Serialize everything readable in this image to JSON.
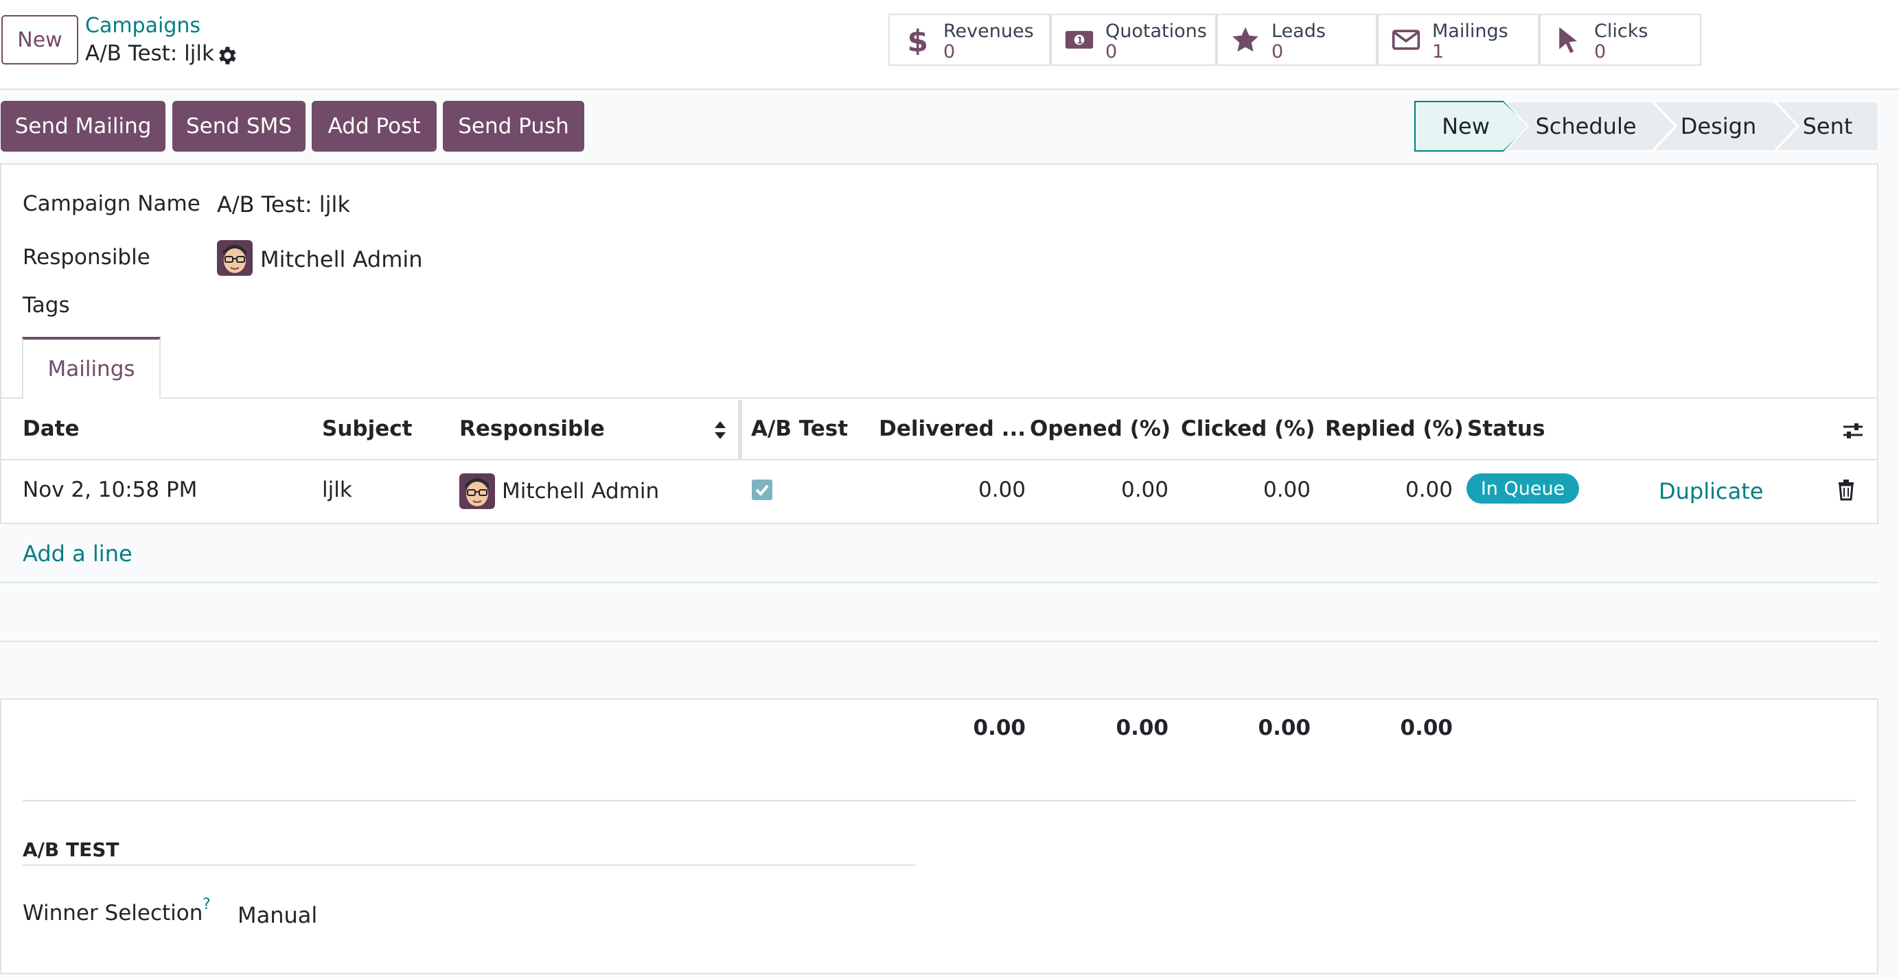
{
  "control_panel": {
    "new_button": "New",
    "breadcrumb_parent": "Campaigns",
    "breadcrumb_current": "A/B Test: ljlk"
  },
  "smart_buttons": [
    {
      "label": "Revenues",
      "value": "0",
      "icon": "dollar-icon"
    },
    {
      "label": "Quotations",
      "value": "0",
      "icon": "money-bill-icon"
    },
    {
      "label": "Leads",
      "value": "0",
      "icon": "star-icon"
    },
    {
      "label": "Mailings",
      "value": "1",
      "icon": "envelope-icon"
    },
    {
      "label": "Clicks",
      "value": "0",
      "icon": "cursor-icon"
    }
  ],
  "actions": {
    "send_mailing": "Send Mailing",
    "send_sms": "Send SMS",
    "add_post": "Add Post",
    "send_push": "Send Push"
  },
  "statusbar": {
    "stages": [
      "New",
      "Schedule",
      "Design",
      "Sent"
    ],
    "current": "New"
  },
  "form": {
    "campaign_name_label": "Campaign Name",
    "campaign_name": "A/B Test: ljlk",
    "responsible_label": "Responsible",
    "responsible": "Mitchell Admin",
    "tags_label": "Tags"
  },
  "tabs": {
    "mailings": "Mailings"
  },
  "table": {
    "headers": {
      "date": "Date",
      "subject": "Subject",
      "responsible": "Responsible",
      "ab_test": "A/B Test",
      "delivered": "Delivered ...",
      "opened": "Opened (%)",
      "clicked": "Clicked (%)",
      "replied": "Replied (%)",
      "status": "Status"
    },
    "row": {
      "date": "Nov 2, 10:58 PM",
      "subject": "ljlk",
      "responsible": "Mitchell Admin",
      "ab_test": true,
      "delivered": "0.00",
      "opened": "0.00",
      "clicked": "0.00",
      "replied": "0.00",
      "status": "In Queue",
      "duplicate": "Duplicate"
    },
    "add_line": "Add a line",
    "totals": {
      "delivered": "0.00",
      "opened": "0.00",
      "clicked": "0.00",
      "replied": "0.00"
    }
  },
  "ab_test_section": {
    "title": "A/B TEST",
    "winner_label": "Winner Selection",
    "help_mark": "?",
    "winner_value": "Manual"
  },
  "colors": {
    "brand": "#714b67",
    "link": "#017e84",
    "badge": "#17a2b8",
    "checkbox": "#7eb4c0"
  }
}
